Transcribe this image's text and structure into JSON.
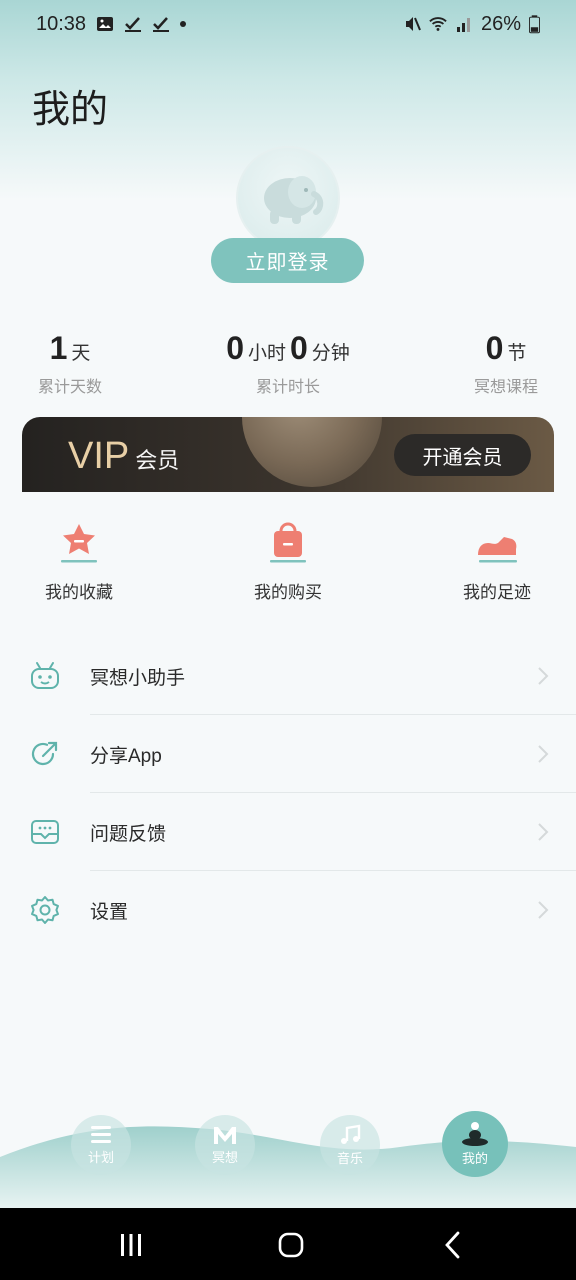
{
  "status_bar": {
    "time": "10:38",
    "battery": "26%"
  },
  "page": {
    "title": "我的"
  },
  "profile": {
    "login_label": "立即登录"
  },
  "stats": {
    "days": {
      "value": "1",
      "unit": "天",
      "label": "累计天数"
    },
    "duration": {
      "hours": "0",
      "hours_unit": "小时",
      "minutes": "0",
      "minutes_unit": "分钟",
      "label": "累计时长"
    },
    "lessons": {
      "value": "0",
      "unit": "节",
      "label": "冥想课程"
    }
  },
  "vip": {
    "title": "VIP",
    "subtitle": "会员",
    "button": "开通会员"
  },
  "quick_actions": [
    {
      "label": "我的收藏",
      "icon": "star-icon"
    },
    {
      "label": "我的购买",
      "icon": "shopping-bag-icon"
    },
    {
      "label": "我的足迹",
      "icon": "shoe-icon"
    }
  ],
  "menu": [
    {
      "label": "冥想小助手",
      "icon": "robot-icon"
    },
    {
      "label": "分享App",
      "icon": "share-icon"
    },
    {
      "label": "问题反馈",
      "icon": "feedback-icon"
    },
    {
      "label": "设置",
      "icon": "gear-icon"
    }
  ],
  "bottom_nav": [
    {
      "label": "计划",
      "icon": "list-icon"
    },
    {
      "label": "冥想",
      "icon": "m-logo-icon"
    },
    {
      "label": "音乐",
      "icon": "music-note-icon"
    },
    {
      "label": "我的",
      "icon": "meditation-person-icon",
      "active": true
    }
  ],
  "colors": {
    "accent": "#7fc3bd",
    "accent_icon": "#5fb3ab",
    "coral": "#ee7f72",
    "vip_gold": "#e8cfa6"
  }
}
